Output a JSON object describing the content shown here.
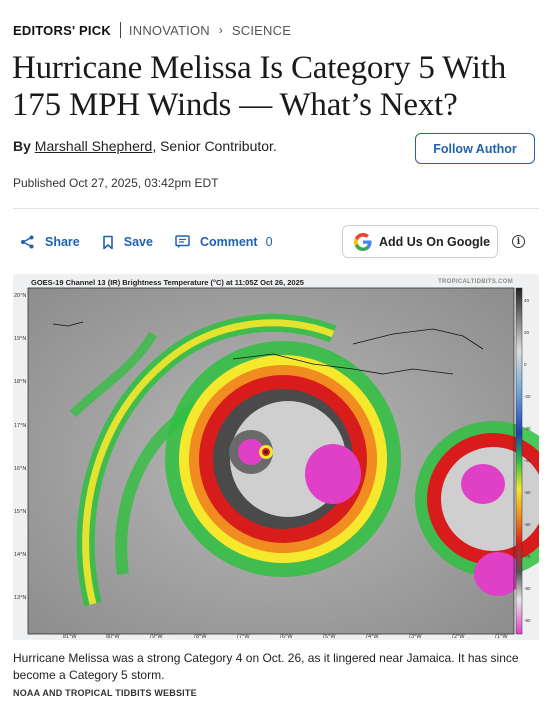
{
  "breadcrumb": {
    "pick": "EDITORS' PICK",
    "section": "INNOVATION",
    "subsection": "SCIENCE"
  },
  "article": {
    "headline": "Hurricane Melissa Is Category 5 With 175 MPH Winds — What’s Next?",
    "by_prefix": "By",
    "author": "Marshall Shepherd",
    "author_role": ", Senior Contributor.",
    "follow_label": "Follow Author",
    "published": "Published Oct 27, 2025, 03:42pm EDT"
  },
  "actions": {
    "share": "Share",
    "save": "Save",
    "comment": "Comment",
    "comment_count": "0",
    "google": "Add Us On Google",
    "info": "i"
  },
  "figure": {
    "title": "GOES-19 Channel 13 (IR) Brightness Temperature (°C) at 11:05Z Oct 26, 2025",
    "watermark": "TROPICALTIDBITS.COM",
    "lat_labels": [
      "20°N",
      "19°N",
      "18°N",
      "17°N",
      "16°N",
      "15°N",
      "14°N",
      "13°N"
    ],
    "lon_labels": [
      "81°W",
      "80°W",
      "79°W",
      "78°W",
      "77°W",
      "76°W",
      "75°W",
      "74°W",
      "73°W",
      "72°W",
      "71°W"
    ],
    "scale_labels": [
      "40",
      "20",
      "0",
      "-20",
      "-30",
      "-40",
      "-50",
      "-60",
      "-70",
      "-80",
      "-90"
    ],
    "caption": "Hurricane Melissa was a strong Category 4 on Oct. 26, as it lingered near Jamaica. It has since become a Category 5 storm.",
    "credit": "NOAA AND TROPICAL TIDBITS WEBSITE"
  },
  "colors": {
    "link_blue": "#1d63b0",
    "text": "#222222"
  }
}
